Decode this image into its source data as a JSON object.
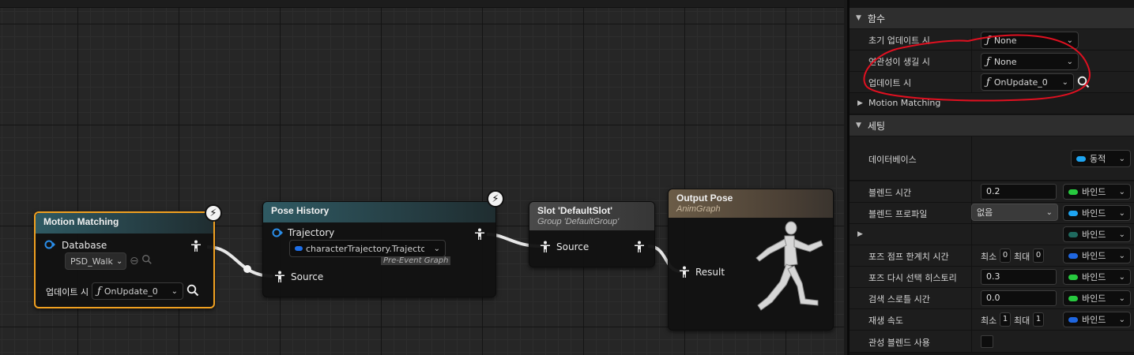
{
  "nodes": {
    "motion_matching": {
      "title": "Motion Matching",
      "database_label": "Database",
      "database_value": "PSD_Walk",
      "on_update_label": "업데이트 시",
      "on_update_value": "OnUpdate_0"
    },
    "pose_history": {
      "title": "Pose History",
      "trajectory_label": "Trajectory",
      "trajectory_value": "characterTrajectory.Trajecto",
      "source_label": "Source",
      "tag": "Pre-Event Graph"
    },
    "slot": {
      "title": "Slot 'DefaultSlot'",
      "subtitle": "Group 'DefaultGroup'",
      "source_label": "Source"
    },
    "output_pose": {
      "title": "Output Pose",
      "subtitle": "AnimGraph",
      "result_label": "Result"
    }
  },
  "panel": {
    "functions": {
      "header": "함수",
      "rows": [
        {
          "label": "초기 업데이트 시",
          "value": "None"
        },
        {
          "label": "연관성이 생길 시",
          "value": "None"
        },
        {
          "label": "업데이트 시",
          "value": "OnUpdate_0"
        }
      ]
    },
    "motion_matching_section": "Motion Matching",
    "settings": {
      "header": "세팅",
      "database_label": "데이터베이스",
      "database_value": "동적",
      "blend_time_label": "블렌드 시간",
      "blend_time_value": "0.2",
      "blend_profile_label": "블렌드 프로파일",
      "blend_profile_value": "없음",
      "pose_jump_label": "포즈 점프 한계치 시간",
      "pose_reselect_label": "포즈 다시 선택 히스토리",
      "pose_reselect_value": "0.3",
      "search_throttle_label": "검색 스로틀 시간",
      "search_throttle_value": "0.0",
      "play_rate_label": "재생 속도",
      "play_rate_min_value": "1",
      "play_rate_max_value": "1",
      "inertial_label": "관성 블렌드 사용",
      "min_label": "최소",
      "max_label": "최대",
      "pose_jump_min_value": "0",
      "pose_jump_max_value": "0",
      "bind_label": "바인드"
    }
  },
  "colors": {
    "selected_outline": "#f0a020",
    "annotation_red": "#e01020",
    "bind_green": "#27c93f",
    "bind_blue": "#1f66e0"
  }
}
